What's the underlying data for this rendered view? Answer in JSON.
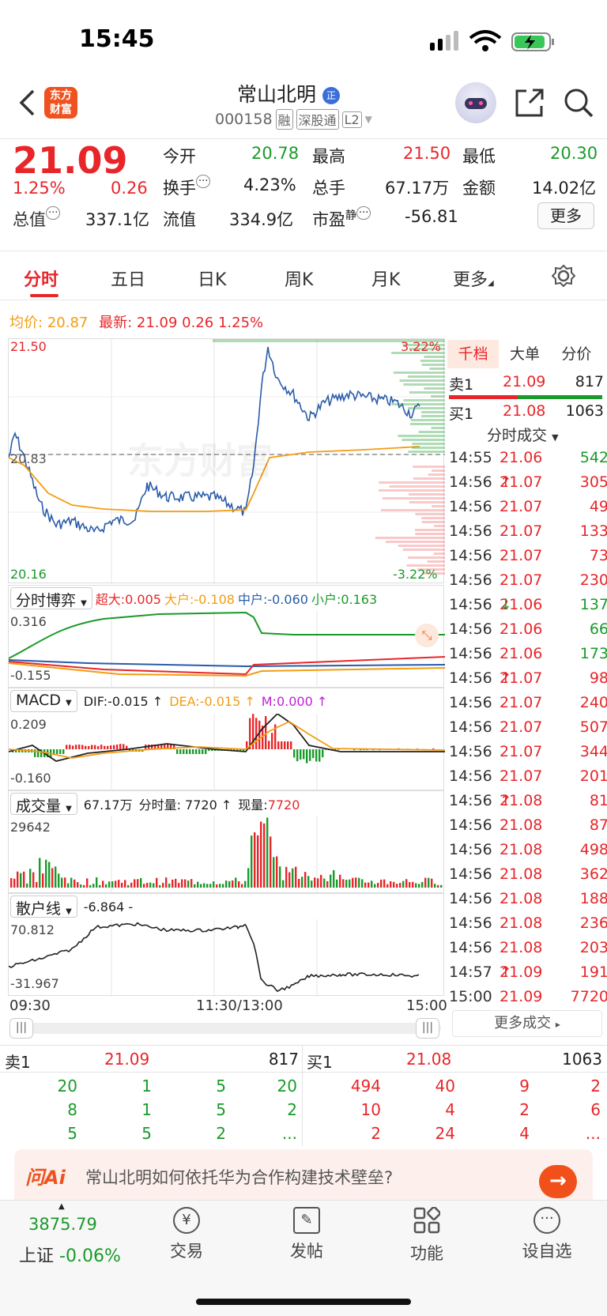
{
  "status_bar": {
    "time": "15:45"
  },
  "header": {
    "stock_name": "常山北明",
    "badge": "正",
    "code": "000158",
    "tags": [
      "融",
      "深股通",
      "L2"
    ],
    "logo_text": "东方财富"
  },
  "quote": {
    "price": "21.09",
    "pct": "1.25%",
    "chg": "0.26",
    "row1": [
      {
        "l": "今开",
        "v": "20.78",
        "c": "green"
      },
      {
        "l": "最高",
        "v": "21.50",
        "c": "red"
      },
      {
        "l": "最低",
        "v": "20.30",
        "c": "green"
      }
    ],
    "row2": [
      {
        "l": "换手",
        "v": "4.23%"
      },
      {
        "l": "总手",
        "v": "67.17万"
      },
      {
        "l": "金额",
        "v": "14.02亿"
      }
    ],
    "row3": [
      {
        "l": "总值",
        "v": "337.1亿"
      },
      {
        "l": "流值",
        "v": "334.9亿"
      },
      {
        "l": "市盈",
        "sup": "静",
        "v": "-56.81"
      }
    ],
    "more": "更多"
  },
  "tabs": [
    "分时",
    "五日",
    "日K",
    "周K",
    "月K",
    "更多"
  ],
  "avg_line": {
    "avg_label": "均价:",
    "avg": "20.87",
    "latest_label": "最新:",
    "latest": "21.09",
    "chg": "0.26",
    "pct": "1.25%"
  },
  "main_chart": {
    "ymax": "21.50",
    "ymin": "20.16",
    "mid": "20.83",
    "pmax": "3.22%",
    "pmin": "-3.22%",
    "watermark": "东方财富"
  },
  "game": {
    "sel": "分时博弈",
    "super": "超大:0.005",
    "big": "大户:-0.108",
    "mid": "中户:-0.060",
    "small": "小户:0.163",
    "ymax": "0.316",
    "ymin": "-0.155"
  },
  "macd": {
    "sel": "MACD",
    "dif": "DIF:-0.015 ↑",
    "dea": "DEA:-0.015 ↑",
    "m": "M:0.000 ↑",
    "ymax": "0.209",
    "ymin": "-0.160"
  },
  "vol": {
    "sel": "成交量",
    "total": "67.17万",
    "fen": "分时量: 7720 ↑",
    "now_label": "现量:",
    "now": "7720",
    "ymax": "29642"
  },
  "retail": {
    "sel": "散户线",
    "val": "-6.864 -",
    "ymax": "70.812",
    "ymin": "-31.967"
  },
  "time_axis": [
    "09:30",
    "11:30/13:00",
    "15:00"
  ],
  "right": {
    "tabs": [
      "千档",
      "大单",
      "分价"
    ],
    "sell1": {
      "l": "卖1",
      "p": "21.09",
      "v": "817"
    },
    "buy1": {
      "l": "买1",
      "p": "21.08",
      "v": "1063"
    },
    "ticks_title": "分时成交",
    "ticks": [
      {
        "t": "14:55",
        "p": "21.06",
        "a": "",
        "v": "542",
        "vc": "green"
      },
      {
        "t": "14:56",
        "p": "21.07",
        "a": "↑",
        "v": "305",
        "vc": "red"
      },
      {
        "t": "14:56",
        "p": "21.07",
        "a": "",
        "v": "49",
        "vc": "red"
      },
      {
        "t": "14:56",
        "p": "21.07",
        "a": "",
        "v": "133",
        "vc": "red"
      },
      {
        "t": "14:56",
        "p": "21.07",
        "a": "",
        "v": "73",
        "vc": "red"
      },
      {
        "t": "14:56",
        "p": "21.07",
        "a": "",
        "v": "230",
        "vc": "red"
      },
      {
        "t": "14:56",
        "p": "21.06",
        "a": "↓",
        "v": "137",
        "vc": "green"
      },
      {
        "t": "14:56",
        "p": "21.06",
        "a": "",
        "v": "66",
        "vc": "green"
      },
      {
        "t": "14:56",
        "p": "21.06",
        "a": "",
        "v": "173",
        "vc": "green"
      },
      {
        "t": "14:56",
        "p": "21.07",
        "a": "↑",
        "v": "98",
        "vc": "red"
      },
      {
        "t": "14:56",
        "p": "21.07",
        "a": "",
        "v": "240",
        "vc": "red"
      },
      {
        "t": "14:56",
        "p": "21.07",
        "a": "",
        "v": "507",
        "vc": "red"
      },
      {
        "t": "14:56",
        "p": "21.07",
        "a": "",
        "v": "344",
        "vc": "red"
      },
      {
        "t": "14:56",
        "p": "21.07",
        "a": "",
        "v": "201",
        "vc": "red"
      },
      {
        "t": "14:56",
        "p": "21.08",
        "a": "↑",
        "v": "81",
        "vc": "red"
      },
      {
        "t": "14:56",
        "p": "21.08",
        "a": "",
        "v": "87",
        "vc": "red"
      },
      {
        "t": "14:56",
        "p": "21.08",
        "a": "",
        "v": "498",
        "vc": "red"
      },
      {
        "t": "14:56",
        "p": "21.08",
        "a": "",
        "v": "362",
        "vc": "red"
      },
      {
        "t": "14:56",
        "p": "21.08",
        "a": "",
        "v": "188",
        "vc": "red"
      },
      {
        "t": "14:56",
        "p": "21.08",
        "a": "",
        "v": "236",
        "vc": "red"
      },
      {
        "t": "14:56",
        "p": "21.08",
        "a": "",
        "v": "203",
        "vc": "red"
      },
      {
        "t": "14:57",
        "p": "21.09",
        "a": "↑",
        "v": "191",
        "vc": "red"
      },
      {
        "t": "15:00",
        "p": "21.09",
        "a": "",
        "v": "7720",
        "vc": "red"
      }
    ],
    "more_ticks": "更多成交"
  },
  "orderbook": {
    "sell": {
      "l": "卖1",
      "p": "21.09",
      "v": "817",
      "rows": [
        [
          "20",
          "1",
          "5",
          "20"
        ],
        [
          "8",
          "1",
          "5",
          "2"
        ],
        [
          "5",
          "5",
          "2",
          "..."
        ]
      ]
    },
    "buy": {
      "l": "买1",
      "p": "21.08",
      "v": "1063",
      "rows": [
        [
          "494",
          "40",
          "9",
          "2"
        ],
        [
          "10",
          "4",
          "2",
          "6"
        ],
        [
          "2",
          "24",
          "4",
          "..."
        ]
      ]
    }
  },
  "ai": {
    "logo": "问Ai",
    "text": "常山北明如何依托华为合作构建技术壁垒?"
  },
  "footer": {
    "index": "3875.79",
    "index_name": "上证",
    "index_pct": "-0.06%",
    "items": [
      "交易",
      "发帖",
      "功能",
      "设自选"
    ]
  },
  "colors": {
    "up": "#e8262a",
    "down": "#1a9a2a",
    "avg": "#f39c12",
    "price": "#2a5caa"
  }
}
